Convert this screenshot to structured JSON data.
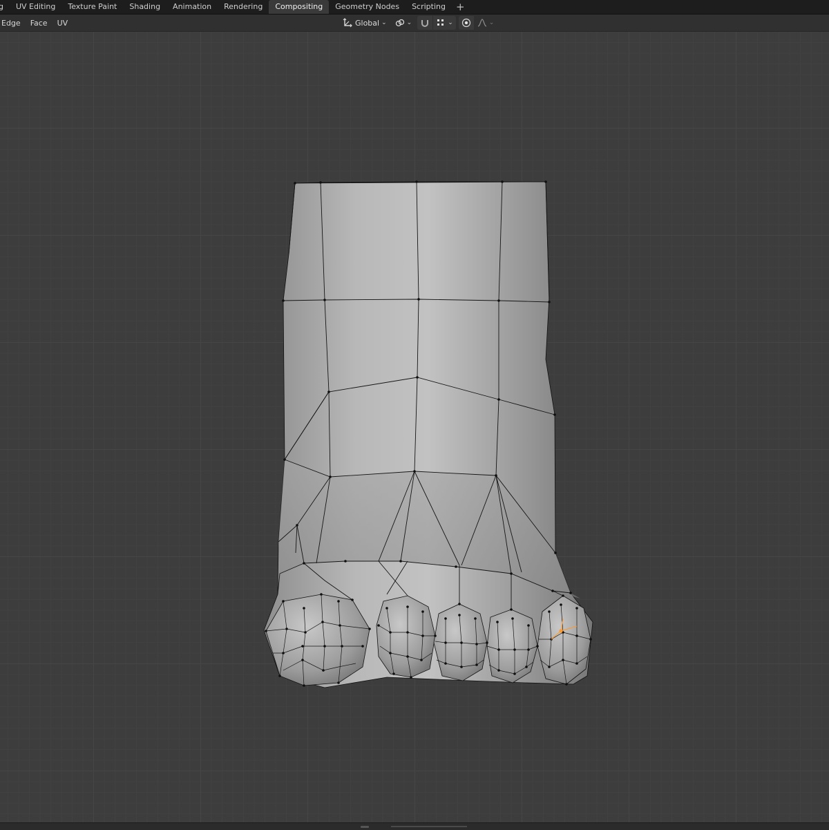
{
  "workspace_tabs": [
    {
      "label": "g",
      "active": false
    },
    {
      "label": "UV Editing",
      "active": false
    },
    {
      "label": "Texture Paint",
      "active": false
    },
    {
      "label": "Shading",
      "active": false
    },
    {
      "label": "Animation",
      "active": false
    },
    {
      "label": "Rendering",
      "active": false
    },
    {
      "label": "Compositing",
      "active": true
    },
    {
      "label": "Geometry Nodes",
      "active": false
    },
    {
      "label": "Scripting",
      "active": false
    }
  ],
  "add_tab_label": "+",
  "header_menu": [
    "Edge",
    "Face",
    "UV"
  ],
  "transform_orientation": "Global",
  "icons": {
    "transform": "transform-orientation-icon",
    "pivot": "pivot-point-icon",
    "snap": "snap-magnet-icon",
    "snap_target": "snap-increment-icon",
    "proportional": "proportional-edit-icon",
    "falloff": "falloff-curve-icon"
  },
  "colors": {
    "active_tab": "#3a3a3a",
    "toggle_on": "#5680c2",
    "selected_vertex": "#ff9a2e"
  }
}
